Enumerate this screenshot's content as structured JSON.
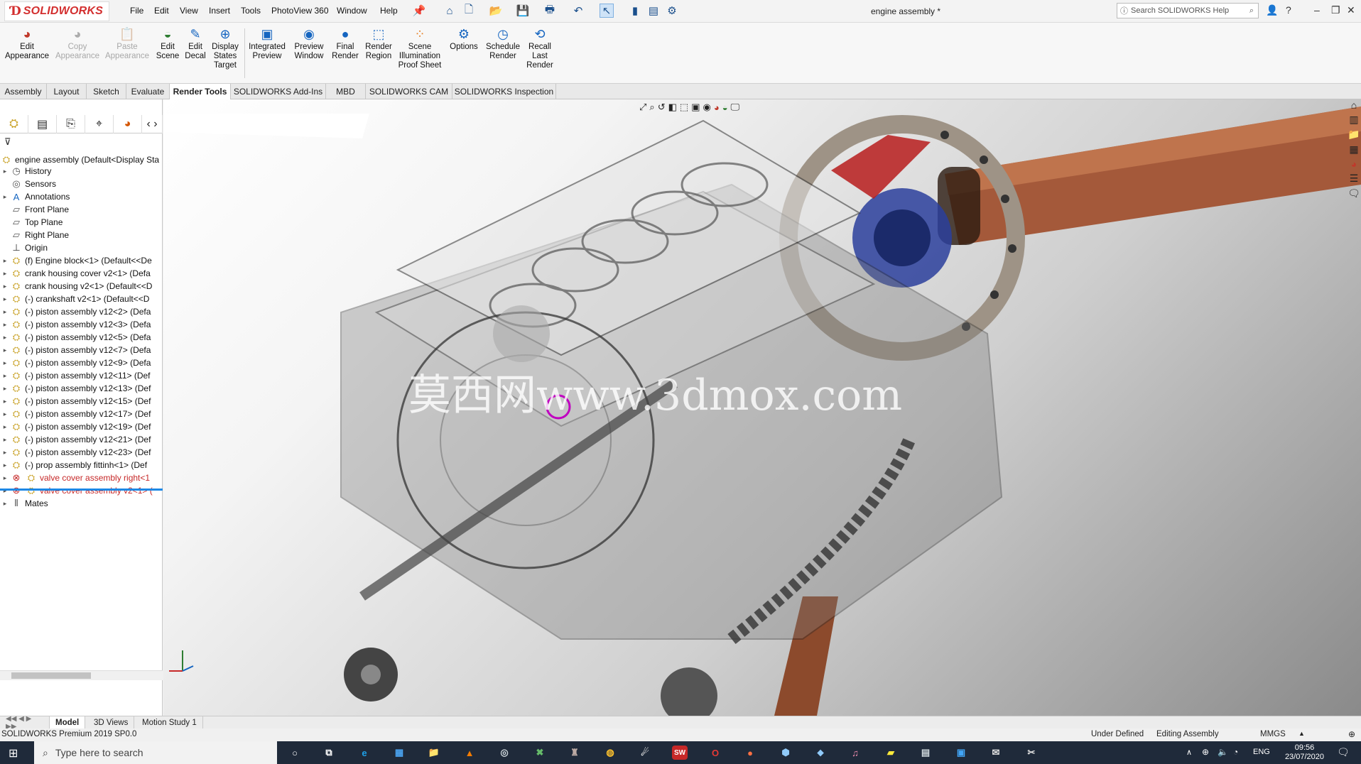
{
  "app": {
    "brand": "SOLIDWORKS",
    "document_title": "engine assembly *",
    "search_placeholder": "Search SOLIDWORKS Help"
  },
  "menu": [
    "File",
    "Edit",
    "View",
    "Insert",
    "Tools",
    "PhotoView 360",
    "Window",
    "Help"
  ],
  "commands": [
    {
      "label": "Edit\nAppearance",
      "icon": "appearance-icon",
      "enabled": true
    },
    {
      "label": "Copy\nAppearance",
      "icon": "copy-appearance-icon",
      "enabled": false
    },
    {
      "label": "Paste\nAppearance",
      "icon": "paste-appearance-icon",
      "enabled": false
    },
    {
      "label": "Edit\nScene",
      "icon": "scene-icon",
      "enabled": true
    },
    {
      "label": "Edit\nDecal",
      "icon": "decal-icon",
      "enabled": true
    },
    {
      "label": "Display\nStates\nTarget",
      "icon": "display-states-icon",
      "enabled": true
    },
    {
      "label": "Integrated\nPreview",
      "icon": "integrated-preview-icon",
      "enabled": true
    },
    {
      "label": "Preview\nWindow",
      "icon": "preview-window-icon",
      "enabled": true
    },
    {
      "label": "Final\nRender",
      "icon": "final-render-icon",
      "enabled": true
    },
    {
      "label": "Render\nRegion",
      "icon": "render-region-icon",
      "enabled": true
    },
    {
      "label": "Scene\nIllumination\nProof Sheet",
      "icon": "illumination-icon",
      "enabled": true
    },
    {
      "label": "Options",
      "icon": "options-icon",
      "enabled": true
    },
    {
      "label": "Schedule\nRender",
      "icon": "schedule-render-icon",
      "enabled": true
    },
    {
      "label": "Recall\nLast\nRender",
      "icon": "recall-render-icon",
      "enabled": true
    }
  ],
  "tabs": [
    "Assembly",
    "Layout",
    "Sketch",
    "Evaluate",
    "Render Tools",
    "SOLIDWORKS Add-Ins",
    "MBD",
    "SOLIDWORKS CAM",
    "SOLIDWORKS Inspection"
  ],
  "active_tab": "Render Tools",
  "tree": {
    "root": "engine assembly  (Default<Display Sta",
    "items": [
      {
        "label": "History",
        "icon": "history-icon",
        "expandable": true,
        "error": false
      },
      {
        "label": "Sensors",
        "icon": "sensor-icon",
        "expandable": false,
        "error": false
      },
      {
        "label": "Annotations",
        "icon": "annotation-icon",
        "expandable": true,
        "error": false
      },
      {
        "label": "Front Plane",
        "icon": "plane-icon",
        "expandable": false,
        "error": false
      },
      {
        "label": "Top Plane",
        "icon": "plane-icon",
        "expandable": false,
        "error": false
      },
      {
        "label": "Right Plane",
        "icon": "plane-icon",
        "expandable": false,
        "error": false
      },
      {
        "label": "Origin",
        "icon": "origin-icon",
        "expandable": false,
        "error": false
      },
      {
        "label": "(f) Engine block<1> (Default<<De",
        "icon": "part-icon",
        "expandable": true,
        "error": false
      },
      {
        "label": "crank housing cover v2<1> (Defa",
        "icon": "part-icon",
        "expandable": true,
        "error": false
      },
      {
        "label": "crank housing v2<1> (Default<<D",
        "icon": "part-icon",
        "expandable": true,
        "error": false
      },
      {
        "label": "(-) crankshaft v2<1> (Default<<D",
        "icon": "part-icon",
        "expandable": true,
        "error": false
      },
      {
        "label": "(-) piston assembly v12<2> (Defa",
        "icon": "subassembly-icon",
        "expandable": true,
        "error": false
      },
      {
        "label": "(-) piston assembly v12<3> (Defa",
        "icon": "subassembly-icon",
        "expandable": true,
        "error": false
      },
      {
        "label": "(-) piston assembly v12<5> (Defa",
        "icon": "subassembly-icon",
        "expandable": true,
        "error": false
      },
      {
        "label": "(-) piston assembly v12<7> (Defa",
        "icon": "subassembly-icon",
        "expandable": true,
        "error": false
      },
      {
        "label": "(-) piston assembly v12<9> (Defa",
        "icon": "subassembly-icon",
        "expandable": true,
        "error": false
      },
      {
        "label": "(-) piston assembly v12<11> (Def",
        "icon": "subassembly-icon",
        "expandable": true,
        "error": false
      },
      {
        "label": "(-) piston assembly v12<13> (Def",
        "icon": "subassembly-icon",
        "expandable": true,
        "error": false
      },
      {
        "label": "(-) piston assembly v12<15> (Def",
        "icon": "subassembly-icon",
        "expandable": true,
        "error": false
      },
      {
        "label": "(-) piston assembly v12<17> (Def",
        "icon": "subassembly-icon",
        "expandable": true,
        "error": false
      },
      {
        "label": "(-) piston assembly v12<19> (Def",
        "icon": "subassembly-icon",
        "expandable": true,
        "error": false
      },
      {
        "label": "(-) piston assembly v12<21> (Def",
        "icon": "subassembly-icon",
        "expandable": true,
        "error": false
      },
      {
        "label": "(-) piston assembly v12<23> (Def",
        "icon": "subassembly-icon",
        "expandable": true,
        "error": false
      },
      {
        "label": "(-) prop assembly fittinh<1> (Def",
        "icon": "subassembly-icon",
        "expandable": true,
        "error": false
      },
      {
        "label": "valve cover assembly right<1",
        "icon": "subassembly-icon",
        "expandable": true,
        "error": true
      },
      {
        "label": "valve cover assembly v2<1> (",
        "icon": "subassembly-icon",
        "expandable": true,
        "error": true
      },
      {
        "label": "Mates",
        "icon": "mates-icon",
        "expandable": true,
        "error": false
      }
    ]
  },
  "watermark": "莫西网www.3dmox.com",
  "bottom_tabs": [
    "Model",
    "3D Views",
    "Motion Study 1"
  ],
  "active_bottom_tab": "Model",
  "status": {
    "left": "SOLIDWORKS Premium 2019 SP0.0",
    "definition": "Under Defined",
    "mode": "Editing Assembly",
    "units": "MMGS"
  },
  "taskbar": {
    "search_placeholder": "Type here to search",
    "language": "ENG",
    "time": "09:56",
    "date": "23/07/2020"
  },
  "colors": {
    "brand_red": "#d32f2f",
    "error_red": "#c62828",
    "copper": "#b5653d",
    "taskbar": "#1f2a3a"
  }
}
